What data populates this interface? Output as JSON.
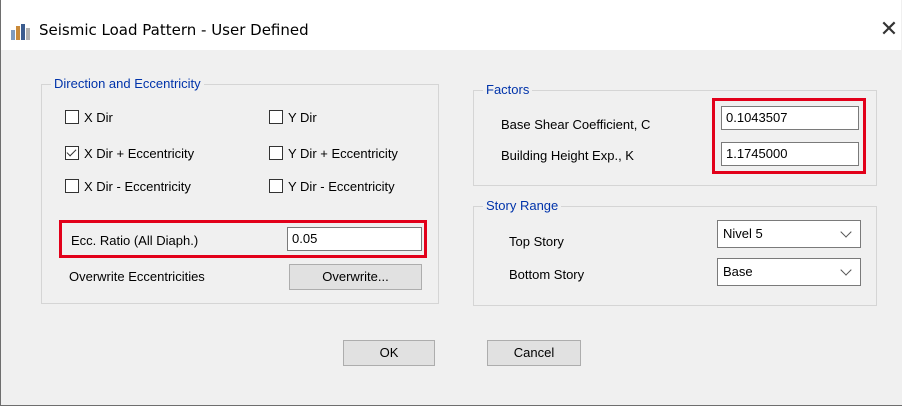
{
  "window": {
    "title": "Seismic Load Pattern - User Defined"
  },
  "direction": {
    "label": "Direction and Eccentricity",
    "checkboxes": [
      {
        "label": "X Dir",
        "checked": false
      },
      {
        "label": "Y Dir",
        "checked": false
      },
      {
        "label": "X Dir + Eccentricity",
        "checked": true
      },
      {
        "label": "Y Dir + Eccentricity",
        "checked": false
      },
      {
        "label": "X Dir - Eccentricity",
        "checked": false
      },
      {
        "label": "Y Dir - Eccentricity",
        "checked": false
      }
    ],
    "ecc_ratio_label": "Ecc. Ratio (All Diaph.)",
    "ecc_ratio_value": "0.05",
    "overwrite_label": "Overwrite Eccentricities",
    "overwrite_button": "Overwrite..."
  },
  "factors": {
    "label": "Factors",
    "base_shear_label": "Base Shear Coefficient, C",
    "base_shear_value": "0.1043507",
    "height_exp_label": "Building Height Exp., K",
    "height_exp_value": "1.1745000"
  },
  "story_range": {
    "label": "Story Range",
    "top_label": "Top Story",
    "top_value": "Nivel 5",
    "bottom_label": "Bottom Story",
    "bottom_value": "Base"
  },
  "buttons": {
    "ok": "OK",
    "cancel": "Cancel"
  },
  "colors": {
    "highlight": "#e2001a",
    "group_label": "#0033aa"
  },
  "icons": [
    "app-icon",
    "close-icon",
    "checkbox-check-icon",
    "chevron-down-icon"
  ]
}
